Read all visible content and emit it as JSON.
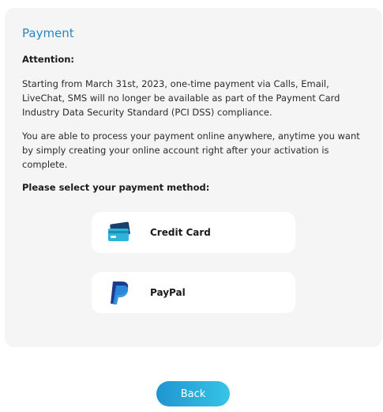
{
  "payment": {
    "title": "Payment",
    "attention_heading": "Attention:",
    "paragraph_1": "Starting from March 31st, 2023, one-time payment via Calls, Email, LiveChat, SMS will no longer be available as part of the Payment Card Industry Data Security Standard (PCI DSS) compliance.",
    "paragraph_2": "You are able to process your payment online anywhere, anytime you want by simply creating your online account right after your activation is complete.",
    "select_label": "Please select your payment method:",
    "methods": [
      {
        "label": "Credit Card",
        "icon": "credit-card-icon"
      },
      {
        "label": "PayPal",
        "icon": "paypal-icon"
      }
    ]
  },
  "back_button": {
    "label": "Back"
  },
  "colors": {
    "accent": "#2a86bd",
    "panel_bg": "#f5f5f5",
    "button_gradient_start": "#1f95cf",
    "button_gradient_end": "#37c4e6"
  }
}
